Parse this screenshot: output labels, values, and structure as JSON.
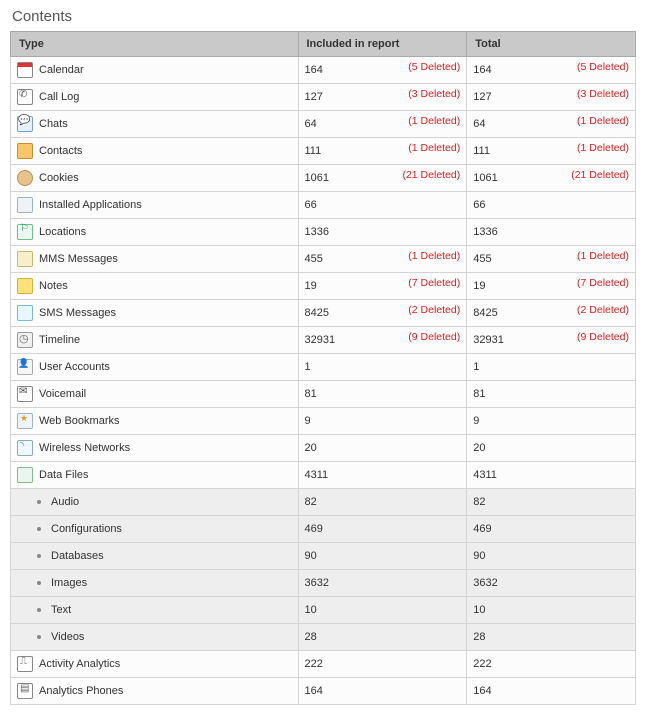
{
  "title": "Contents",
  "columns": {
    "type": "Type",
    "included": "Included in report",
    "total": "Total"
  },
  "rows": [
    {
      "kind": "cat",
      "icon": "calendar",
      "label": "Calendar",
      "inc": "164",
      "incDel": "(5 Deleted)",
      "tot": "164",
      "totDel": "(5 Deleted)"
    },
    {
      "kind": "cat",
      "icon": "calllog",
      "label": "Call Log",
      "inc": "127",
      "incDel": "(3 Deleted)",
      "tot": "127",
      "totDel": "(3 Deleted)"
    },
    {
      "kind": "cat",
      "icon": "chats",
      "label": "Chats",
      "inc": "64",
      "incDel": "(1 Deleted)",
      "tot": "64",
      "totDel": "(1 Deleted)"
    },
    {
      "kind": "cat",
      "icon": "contacts",
      "label": "Contacts",
      "inc": "111",
      "incDel": "(1 Deleted)",
      "tot": "111",
      "totDel": "(1 Deleted)"
    },
    {
      "kind": "cat",
      "icon": "cookies",
      "label": "Cookies",
      "inc": "1061",
      "incDel": "(21 Deleted)",
      "tot": "1061",
      "totDel": "(21 Deleted)"
    },
    {
      "kind": "cat",
      "icon": "apps",
      "label": "Installed Applications",
      "inc": "66",
      "incDel": "",
      "tot": "66",
      "totDel": ""
    },
    {
      "kind": "cat",
      "icon": "locations",
      "label": "Locations",
      "inc": "1336",
      "incDel": "",
      "tot": "1336",
      "totDel": ""
    },
    {
      "kind": "cat",
      "icon": "mms",
      "label": "MMS Messages",
      "inc": "455",
      "incDel": "(1 Deleted)",
      "tot": "455",
      "totDel": "(1 Deleted)"
    },
    {
      "kind": "cat",
      "icon": "notes",
      "label": "Notes",
      "inc": "19",
      "incDel": "(7 Deleted)",
      "tot": "19",
      "totDel": "(7 Deleted)"
    },
    {
      "kind": "cat",
      "icon": "sms",
      "label": "SMS Messages",
      "inc": "8425",
      "incDel": "(2 Deleted)",
      "tot": "8425",
      "totDel": "(2 Deleted)"
    },
    {
      "kind": "cat",
      "icon": "timeline",
      "label": "Timeline",
      "inc": "32931",
      "incDel": "(9 Deleted)",
      "tot": "32931",
      "totDel": "(9 Deleted)"
    },
    {
      "kind": "cat",
      "icon": "users",
      "label": "User Accounts",
      "inc": "1",
      "incDel": "",
      "tot": "1",
      "totDel": ""
    },
    {
      "kind": "cat",
      "icon": "voicemail",
      "label": "Voicemail",
      "inc": "81",
      "incDel": "",
      "tot": "81",
      "totDel": ""
    },
    {
      "kind": "cat",
      "icon": "bookmarks",
      "label": "Web Bookmarks",
      "inc": "9",
      "incDel": "",
      "tot": "9",
      "totDel": ""
    },
    {
      "kind": "cat",
      "icon": "wifi",
      "label": "Wireless Networks",
      "inc": "20",
      "incDel": "",
      "tot": "20",
      "totDel": ""
    },
    {
      "kind": "cat",
      "icon": "datafiles",
      "label": "Data Files",
      "inc": "4311",
      "incDel": "",
      "tot": "4311",
      "totDel": ""
    },
    {
      "kind": "sub",
      "icon": "",
      "label": "Audio",
      "inc": "82",
      "incDel": "",
      "tot": "82",
      "totDel": ""
    },
    {
      "kind": "sub",
      "icon": "",
      "label": "Configurations",
      "inc": "469",
      "incDel": "",
      "tot": "469",
      "totDel": ""
    },
    {
      "kind": "sub",
      "icon": "",
      "label": "Databases",
      "inc": "90",
      "incDel": "",
      "tot": "90",
      "totDel": ""
    },
    {
      "kind": "sub",
      "icon": "",
      "label": "Images",
      "inc": "3632",
      "incDel": "",
      "tot": "3632",
      "totDel": ""
    },
    {
      "kind": "sub",
      "icon": "",
      "label": "Text",
      "inc": "10",
      "incDel": "",
      "tot": "10",
      "totDel": ""
    },
    {
      "kind": "sub",
      "icon": "",
      "label": "Videos",
      "inc": "28",
      "incDel": "",
      "tot": "28",
      "totDel": ""
    },
    {
      "kind": "cat",
      "icon": "activity",
      "label": "Activity Analytics",
      "inc": "222",
      "incDel": "",
      "tot": "222",
      "totDel": ""
    },
    {
      "kind": "cat",
      "icon": "phones",
      "label": "Analytics Phones",
      "inc": "164",
      "incDel": "",
      "tot": "164",
      "totDel": ""
    }
  ]
}
